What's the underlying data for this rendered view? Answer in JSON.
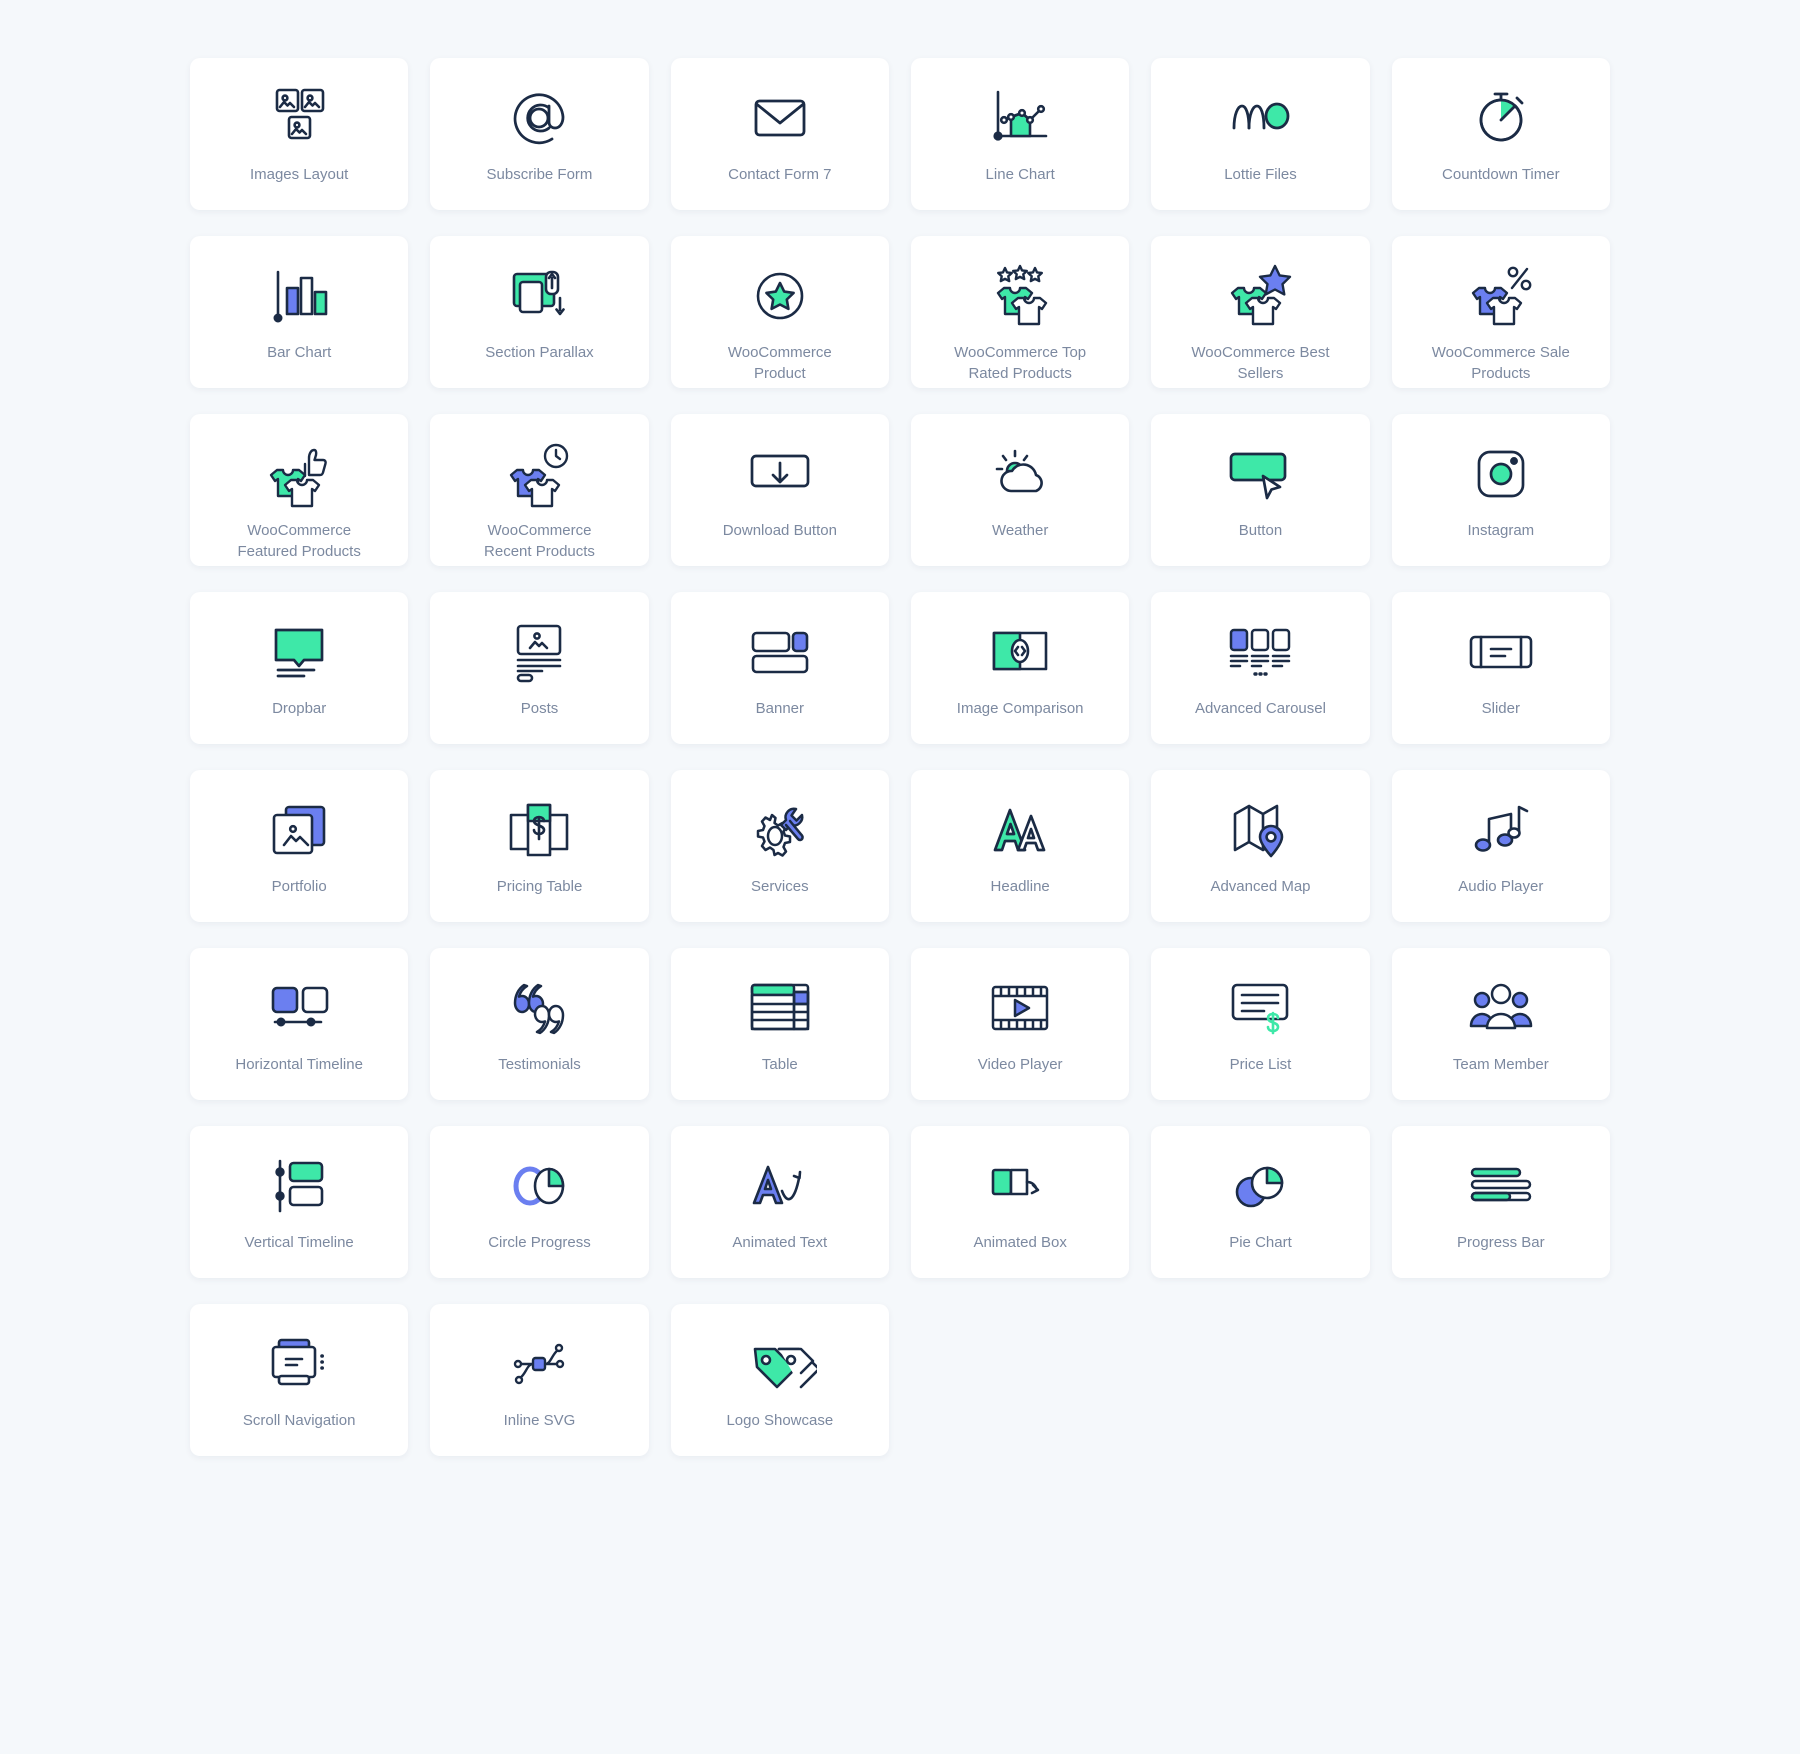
{
  "theme": {
    "page_background": "#f5f8fb",
    "card_background": "#ffffff",
    "label_color": "#7c89a0",
    "ink": "#1b2b45",
    "accent_green": "#3ee8a8",
    "accent_blue": "#6b7ff0"
  },
  "grid": {
    "columns": 6,
    "items": [
      {
        "label": "Images Layout",
        "icon": "images-layout-icon"
      },
      {
        "label": "Subscribe Form",
        "icon": "at-sign-icon"
      },
      {
        "label": "Contact Form 7",
        "icon": "envelope-icon"
      },
      {
        "label": "Line Chart",
        "icon": "line-chart-icon"
      },
      {
        "label": "Lottie Files",
        "icon": "lottie-files-icon"
      },
      {
        "label": "Countdown Timer",
        "icon": "stopwatch-icon"
      },
      {
        "label": "Bar Chart",
        "icon": "bar-chart-icon"
      },
      {
        "label": "Section Parallax",
        "icon": "section-parallax-icon"
      },
      {
        "label": "WooCommerce Product",
        "icon": "star-circle-icon"
      },
      {
        "label": "WooCommerce Top Rated Products",
        "icon": "shirts-stars-icon"
      },
      {
        "label": "WooCommerce Best Sellers",
        "icon": "shirts-star-icon"
      },
      {
        "label": "WooCommerce Sale Products",
        "icon": "shirts-percent-icon"
      },
      {
        "label": "WooCommerce Featured Products",
        "icon": "shirts-thumbup-icon"
      },
      {
        "label": "WooCommerce Recent Products",
        "icon": "shirts-clock-icon"
      },
      {
        "label": "Download Button",
        "icon": "download-button-icon"
      },
      {
        "label": "Weather",
        "icon": "weather-icon"
      },
      {
        "label": "Button",
        "icon": "button-cursor-icon"
      },
      {
        "label": "Instagram",
        "icon": "instagram-icon"
      },
      {
        "label": "Dropbar",
        "icon": "dropbar-icon"
      },
      {
        "label": "Posts",
        "icon": "posts-icon"
      },
      {
        "label": "Banner",
        "icon": "banner-icon"
      },
      {
        "label": "Image Comparison",
        "icon": "image-comparison-icon"
      },
      {
        "label": "Advanced Carousel",
        "icon": "advanced-carousel-icon"
      },
      {
        "label": "Slider",
        "icon": "slider-icon"
      },
      {
        "label": "Portfolio",
        "icon": "portfolio-icon"
      },
      {
        "label": "Pricing Table",
        "icon": "pricing-table-icon"
      },
      {
        "label": "Services",
        "icon": "gear-wrench-icon"
      },
      {
        "label": "Headline",
        "icon": "headline-aa-icon"
      },
      {
        "label": "Advanced Map",
        "icon": "map-pin-icon"
      },
      {
        "label": "Audio Player",
        "icon": "music-notes-icon"
      },
      {
        "label": "Horizontal Timeline",
        "icon": "horizontal-timeline-icon"
      },
      {
        "label": "Testimonials",
        "icon": "quote-marks-icon"
      },
      {
        "label": "Table",
        "icon": "table-icon"
      },
      {
        "label": "Video Player",
        "icon": "film-play-icon"
      },
      {
        "label": "Price List",
        "icon": "price-list-icon"
      },
      {
        "label": "Team Member",
        "icon": "team-member-icon"
      },
      {
        "label": "Vertical Timeline",
        "icon": "vertical-timeline-icon"
      },
      {
        "label": "Circle Progress",
        "icon": "circle-progress-icon"
      },
      {
        "label": "Animated Text",
        "icon": "animated-text-icon"
      },
      {
        "label": "Animated Box",
        "icon": "animated-box-icon"
      },
      {
        "label": "Pie Chart",
        "icon": "pie-chart-icon"
      },
      {
        "label": "Progress Bar",
        "icon": "progress-bar-icon"
      },
      {
        "label": "Scroll Navigation",
        "icon": "scroll-navigation-icon"
      },
      {
        "label": "Inline SVG",
        "icon": "inline-svg-icon"
      },
      {
        "label": "Logo Showcase",
        "icon": "tags-icon"
      }
    ]
  }
}
